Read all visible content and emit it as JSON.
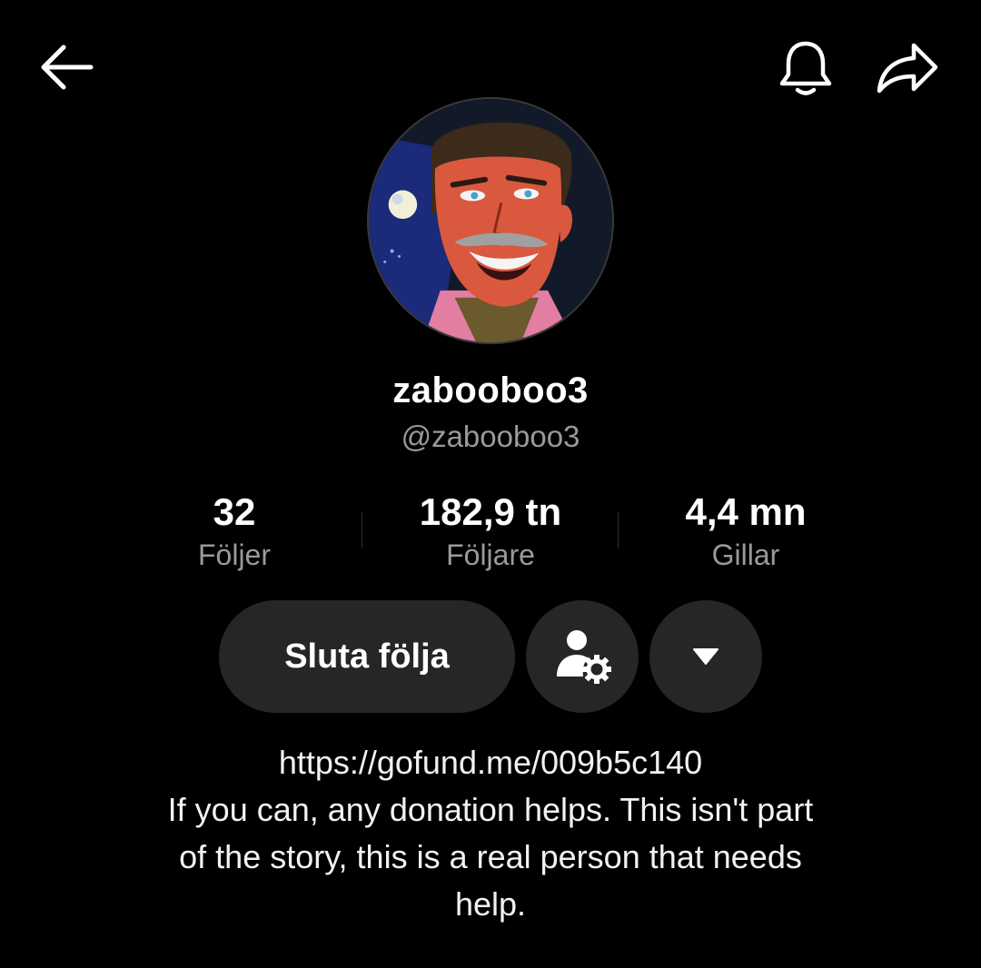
{
  "header": {
    "back_icon": "arrow-left-icon",
    "notification_icon": "bell-icon",
    "share_icon": "share-arrow-icon"
  },
  "profile": {
    "avatar_icon": "cartoon-man-avatar",
    "display_name": "zabooboo3",
    "handle": "@zabooboo3"
  },
  "stats": [
    {
      "value": "32",
      "label": "Följer"
    },
    {
      "value": "182,9 tn",
      "label": "Följare"
    },
    {
      "value": "4,4 mn",
      "label": "Gillar"
    }
  ],
  "actions": {
    "unfollow_label": "Sluta följa",
    "friend_settings_icon": "person-gear-icon",
    "more_icon": "caret-down-icon"
  },
  "bio": {
    "link": "https://gofund.me/009b5c140",
    "line1": "If you can, any donation helps. This isn't part",
    "line2": "of the story, this is a real person that needs",
    "line3": "help."
  },
  "colors": {
    "background": "#000000",
    "button_bg": "#262626",
    "secondary_text": "#9a9a9a"
  }
}
